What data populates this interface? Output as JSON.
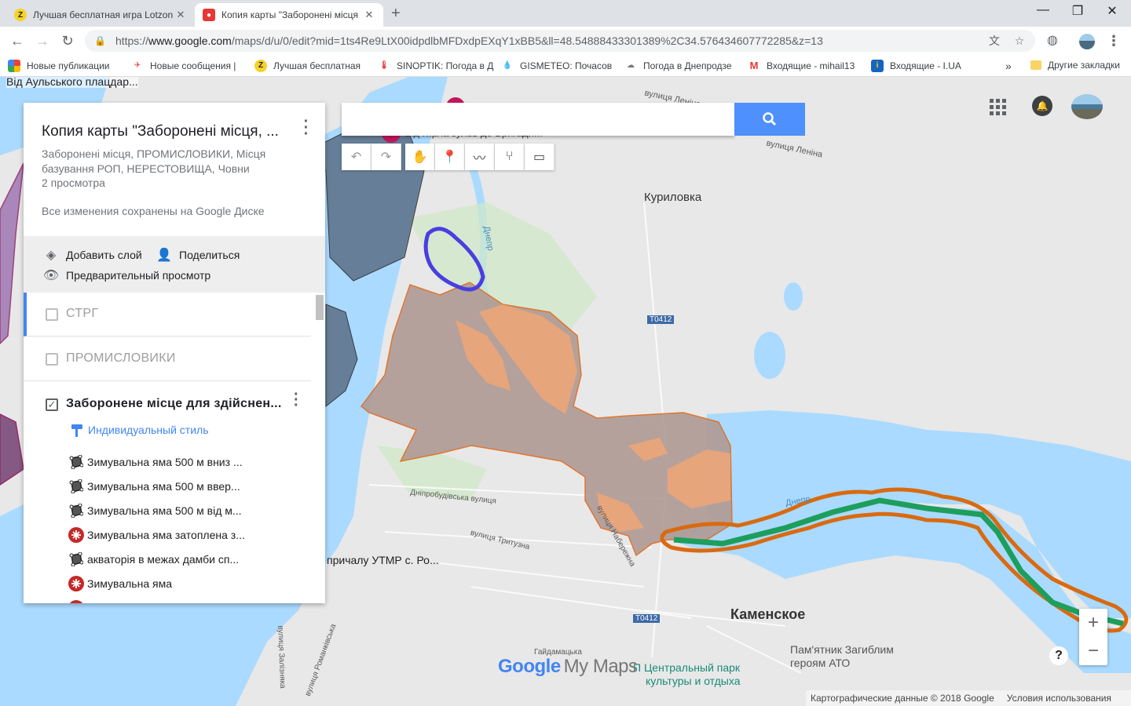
{
  "browser": {
    "tabs": [
      {
        "title": "Лучшая бесплатная игра Lotzon",
        "active": false
      },
      {
        "title": "Копия карты \"Заборонені місця",
        "active": true
      }
    ],
    "url_prefix": "https://",
    "url_host": "www.google.com",
    "url_rest": "/maps/d/u/0/edit?mid=1ts4Re9LtX00idpdlbMFDxdpEXqY1xBB5&ll=48.54888433301389%2C34.576434607772285&z=13",
    "bookmarks": [
      "Новые публикации",
      "Новые сообщения |",
      "Лучшая бесплатная",
      "SINOPTIK: Погода в Д",
      "GISMETEO: Почасов",
      "Погода в Днепродзе",
      "Входящие - mihail13",
      "Входящие - I.UA"
    ],
    "bookmarks_more": "»",
    "other_bookmarks": "Другие закладки"
  },
  "map": {
    "top_layer_label": "Від Аульського плацдар...",
    "popup_label": "Від гирла зульв до Бригади...",
    "labels": [
      {
        "text": "вулиця Леніна",
        "id": "street-lenina-1"
      },
      {
        "text": "вулиця Леніна",
        "id": "street-lenina-2"
      },
      {
        "text": "Куриловка",
        "id": "kurilovka"
      },
      {
        "text": "Днепр",
        "id": "dnepr-1"
      },
      {
        "text": "T0412",
        "id": "road-t0412-1"
      },
      {
        "text": "T0412",
        "id": "road-t0412-2"
      },
      {
        "text": "Дніпробудівська вулиця",
        "id": "street-dniprobud"
      },
      {
        "text": "вулиця Тритузна",
        "id": "street-trytuzna"
      },
      {
        "text": "вулиця Набережна",
        "id": "street-naberezhna"
      },
      {
        "text": "Днепр",
        "id": "dnepr-2"
      },
      {
        "text": "Каменское",
        "id": "kamenskoe"
      },
      {
        "text": "Пам'ятник Загиблим",
        "id": "monument-1"
      },
      {
        "text": "героям АТО",
        "id": "monument-2"
      },
      {
        "text": "П Центральный парк",
        "id": "park-1"
      },
      {
        "text": "культуры и отдыха",
        "id": "park-2"
      },
      {
        "text": "вулиця Залізнякa",
        "id": "street-zaliznyaka"
      },
      {
        "text": "вулиця Романківська",
        "id": "street-romankivska"
      },
      {
        "text": "Гайдамацька",
        "id": "street-haidamatska"
      },
      {
        "text": "причалу УТМР с. Ро...",
        "id": "pier-label"
      }
    ],
    "search_placeholder": "",
    "logo_google": "Google",
    "logo_mymaps": "My Maps",
    "attribution": "Картографические данные © 2018 Google",
    "terms": "Условия использования",
    "zoom_in": "+",
    "zoom_out": "−",
    "help": "?"
  },
  "panel": {
    "title": "Копия карты \"Заборонені місця, ...",
    "subtitle": "Заборонені місця, ПРОМИСЛОВИКИ, Місця базування РОП, НЕРЕСТОВИЩА, Човни",
    "views": "2 просмотра",
    "saved": "Все изменения сохранены на Google Диске",
    "add_layer": "Добавить слой",
    "share": "Поделиться",
    "preview": "Предварительный просмотр",
    "layers": [
      {
        "name": "СТРГ",
        "checked": false
      },
      {
        "name": "ПРОМИСЛОВИКИ",
        "checked": false
      },
      {
        "name": "Заборонене місце для здійснен...",
        "checked": true
      }
    ],
    "style_link": "Индивидуальный стиль",
    "items": [
      {
        "label": "Зимувальна яма 500 м вниз ...",
        "icon": "polygon-icon"
      },
      {
        "label": "Зимувальна яма 500 м ввер...",
        "icon": "polygon-icon"
      },
      {
        "label": "Зимувальна яма 500 м від м...",
        "icon": "polygon-icon"
      },
      {
        "label": "Зимувальна яма затоплена з...",
        "icon": "red-marker-icon"
      },
      {
        "label": "акваторія в межах дамби сп...",
        "icon": "polygon-icon"
      },
      {
        "label": "Зимувальна яма",
        "icon": "red-marker-icon"
      }
    ]
  },
  "colors": {
    "water": "#aadaff",
    "forbidden_zone_fill": "#b09a94",
    "zone_stroke": "#e06a1e",
    "green_line": "#1e9e5c",
    "orange_line": "#d96a10",
    "blue_loop": "#4a3ee0",
    "dark_zone": "#5b6f86",
    "accent": "#4285f4"
  }
}
